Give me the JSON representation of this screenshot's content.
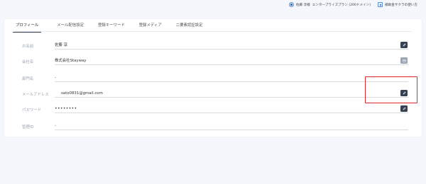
{
  "topbar": {
    "user_label": "佐藤 淳様",
    "plan_label": "エンタープライズプラン (200ドメイン)",
    "help_label": "補助金サクラの使い方"
  },
  "tabs": [
    {
      "label": "プロフィール",
      "active": true
    },
    {
      "label": "メール配信設定",
      "active": false
    },
    {
      "label": "登録キーワード",
      "active": false
    },
    {
      "label": "登録メディア",
      "active": false
    },
    {
      "label": "二要素認証設定",
      "active": false
    }
  ],
  "profile": {
    "name": {
      "label": "お名前",
      "value": "佐藤 淳"
    },
    "company": {
      "label": "会社名",
      "value": "株式会社Stayway"
    },
    "department": {
      "label": "部門名",
      "value": "-"
    },
    "email": {
      "label": "メールアドレス",
      "value": "sato0831@gmail.com"
    },
    "password": {
      "label": "パスワード",
      "value": "••••••••"
    },
    "role": {
      "label": "管理ID",
      "value": "-"
    }
  },
  "colors": {
    "highlight": "#e0252b",
    "edit_button": "#364152",
    "edit_button_disabled": "#9aa6b6"
  },
  "icons": {
    "edit": "pencil-icon",
    "calendar": "calendar-icon",
    "user": "user-icon",
    "help": "help-icon"
  }
}
